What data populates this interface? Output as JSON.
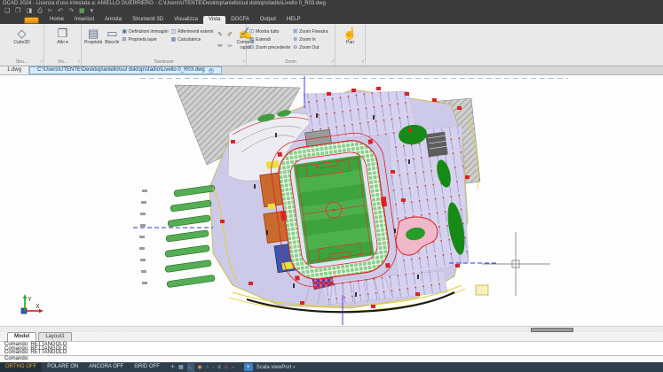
{
  "window": {
    "title": "GCAD 2024  -  Licenza d'uso intestata a: ANIELLO GUERRIERO  -  C:\\Users\\UTENTE\\Desktop\\aniello\\sul dsktop\\stadio\\Livello 0_R03.dwg"
  },
  "quick_access": {
    "icons": [
      {
        "name": "new-file",
        "glyph": "❏"
      },
      {
        "name": "open-file",
        "glyph": "❐"
      },
      {
        "name": "save",
        "glyph": "◨"
      },
      {
        "name": "print",
        "glyph": "⎙"
      },
      {
        "name": "plot",
        "glyph": "⌲"
      },
      {
        "name": "undo",
        "glyph": "↶"
      },
      {
        "name": "redo",
        "glyph": "↷"
      },
      {
        "name": "layer-table",
        "glyph": "▦"
      },
      {
        "name": "more",
        "glyph": "▾"
      }
    ]
  },
  "menu_tabs": [
    {
      "label": "Home"
    },
    {
      "label": "Inserisci"
    },
    {
      "label": "Annota"
    },
    {
      "label": "Strumenti 3D"
    },
    {
      "label": "Visualizza"
    },
    {
      "label": "Vista",
      "active": true
    },
    {
      "label": "DOCFA"
    },
    {
      "label": "Output"
    },
    {
      "label": "HELP"
    }
  ],
  "ribbon": {
    "cubo3d": {
      "label": "Cubo3D",
      "group": "Stru...",
      "icon": "◇"
    },
    "alto": {
      "label": "Alto",
      "caret": "▾",
      "group": "Vis...",
      "icon": "❒"
    },
    "tavolozze": {
      "group": "Tavolozze",
      "proprieta": "Proprietà",
      "blocchi": "Blocchi",
      "items": [
        "Definizioni immagini",
        "Proprietà layer",
        "Riferimenti esterni",
        "Calcolatrice"
      ],
      "item_icons": [
        "▣",
        "⊞",
        "◫",
        "▦"
      ],
      "mini_icons": [
        "✎",
        "✐",
        "✏",
        "✑"
      ],
      "comandi": "Comandi rapidi",
      "comandi_icon": "✍"
    },
    "zoom": {
      "group": "Zoom",
      "items": [
        "Mostra tutto",
        "Estendi",
        "Zoom precedente",
        "Zoom Finestra",
        "Zoom In",
        "Zoom Out"
      ],
      "icons": [
        "⊡",
        "⊠",
        "⊟",
        "⊞",
        "⊕",
        "⊖"
      ]
    },
    "pan": {
      "label": "Pan",
      "icon": "☝"
    }
  },
  "file_tabs": {
    "tab1": "1.dwg",
    "tab2": "C:\\Users\\UTENTE\\Desktop\\aniello\\sul dsktop\\stadio\\Livello 0_R03.dwg",
    "close": "✕"
  },
  "canvas": {
    "ucs": {
      "x": "X",
      "y": "Y"
    }
  },
  "panels_bottom": {
    "model": "Model",
    "layout1": "Layout1",
    "history": [
      "Comando: RETTANGOLO",
      "Comando: RETTANGOLO",
      "Comando: RETTANGOLO"
    ],
    "prompt": "Comando:"
  },
  "status_bar": {
    "ortho": "ORTHO OFF",
    "polare": "POLARE ON",
    "ancora": "ANCORA OFF",
    "grid": "GRID OFF",
    "plus": "+",
    "scale": "Scala viewPort",
    "caret": "▾",
    "icons": [
      {
        "name": "snap-icon",
        "glyph": "✛"
      },
      {
        "name": "grid-snap-icon",
        "glyph": "▦"
      },
      {
        "name": "ortho-mode-icon",
        "glyph": "∟"
      },
      {
        "name": "polar-icon",
        "glyph": "◉"
      },
      {
        "name": "osnap-icon",
        "glyph": "∴"
      },
      {
        "name": "otrack-icon",
        "glyph": "∙"
      },
      {
        "name": "lineweight-icon",
        "glyph": "≡"
      },
      {
        "name": "magnet-icon",
        "glyph": "∪"
      },
      {
        "name": "lock-icon",
        "glyph": "⌐"
      }
    ]
  },
  "colors": {
    "status_bg": "#2e3e4c",
    "ortho_text": "#e2a23c",
    "active_tab_bg": "#d8ebfa",
    "field_green": "#3da33d",
    "site_lavender": "#cdc9e8",
    "accent_red": "#dd2222",
    "road_yellow": "#e0d22a",
    "hatch_gray": "#c8c8c8"
  }
}
